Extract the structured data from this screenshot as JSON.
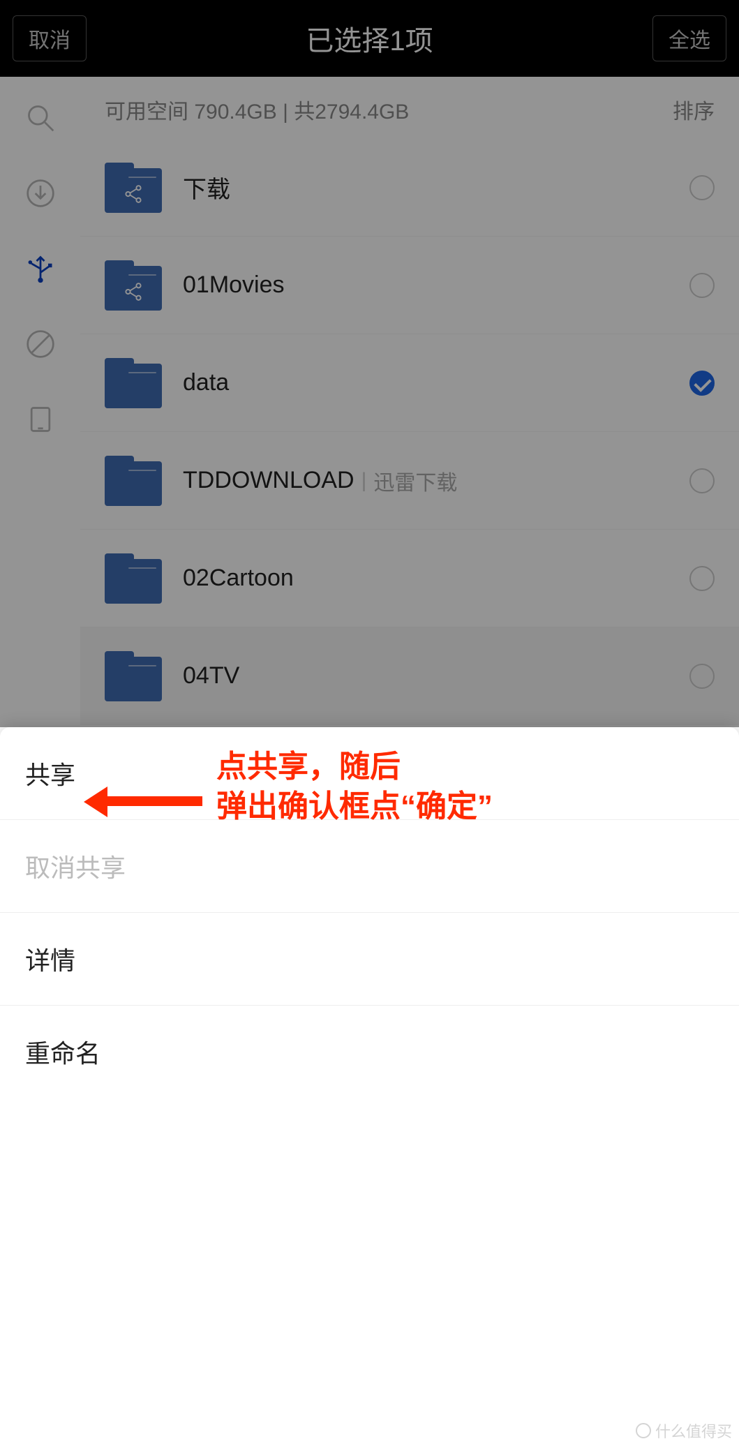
{
  "header": {
    "cancel": "取消",
    "title": "已选择1项",
    "select_all": "全选"
  },
  "storage": {
    "text": "可用空间 790.4GB | 共2794.4GB",
    "sort": "排序"
  },
  "folders": [
    {
      "name": "下载",
      "shared": true,
      "selected": false,
      "subtitle": ""
    },
    {
      "name": "01Movies",
      "shared": true,
      "selected": false,
      "subtitle": ""
    },
    {
      "name": "data",
      "shared": false,
      "selected": true,
      "subtitle": ""
    },
    {
      "name": "TDDOWNLOAD",
      "shared": false,
      "selected": false,
      "subtitle": "迅雷下载"
    },
    {
      "name": "02Cartoon",
      "shared": false,
      "selected": false,
      "subtitle": ""
    },
    {
      "name": "04TV",
      "shared": false,
      "selected": false,
      "subtitle": ""
    }
  ],
  "sheet": {
    "share": "共享",
    "unshare": "取消共享",
    "details": "详情",
    "rename": "重命名"
  },
  "annotation": {
    "line1": "点共享，随后",
    "line2": "弹出确认框点“确定”"
  },
  "watermark": "什么值得买"
}
